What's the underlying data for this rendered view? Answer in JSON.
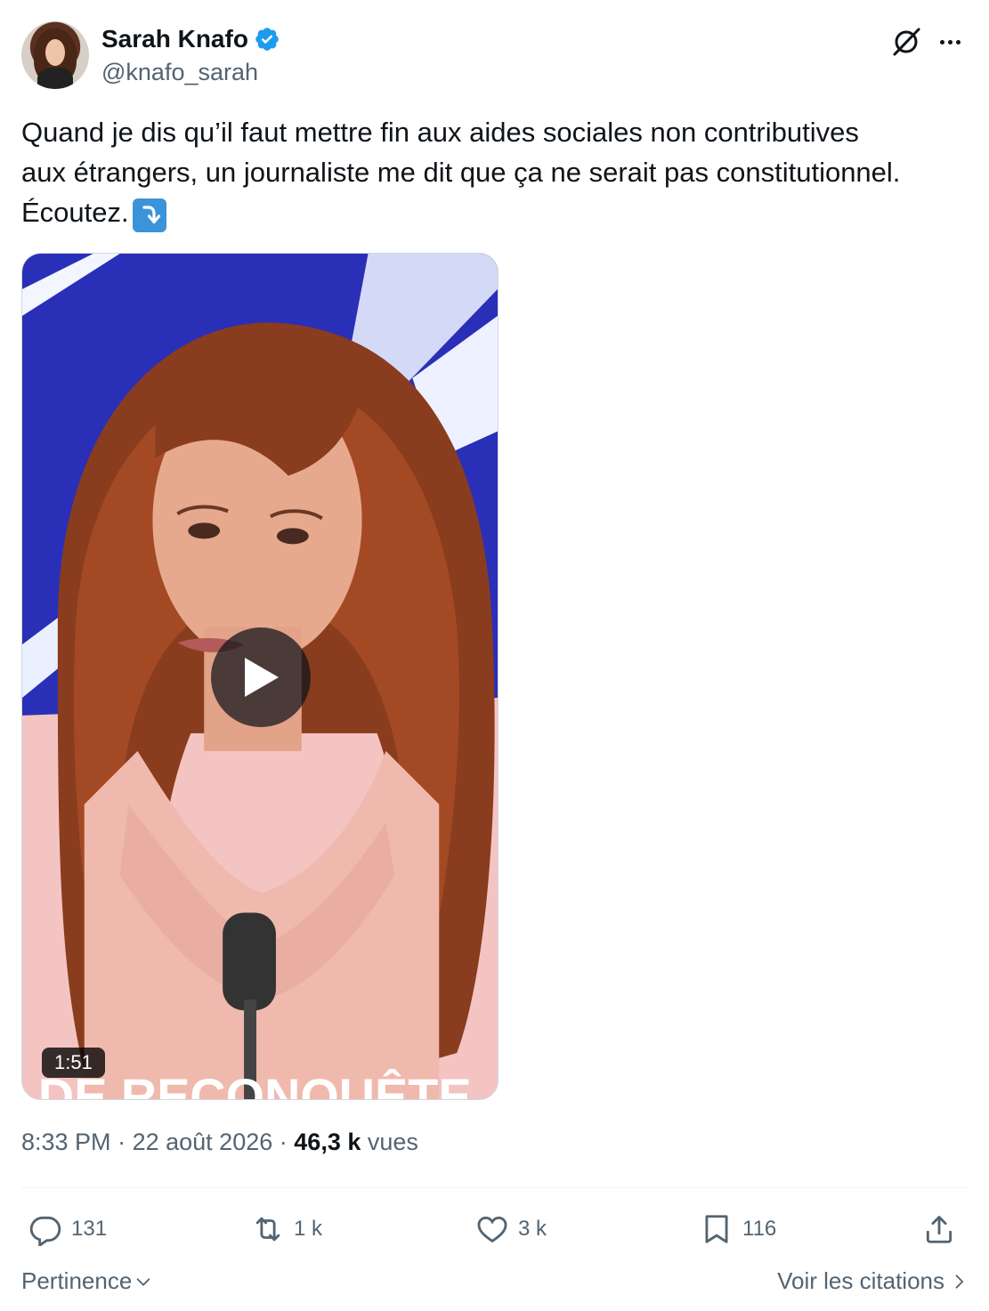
{
  "author": {
    "name": "Sarah Knafo",
    "handle": "@knafo_sarah",
    "verified": true
  },
  "tweet": {
    "text_line1": "Quand je dis qu’il faut mettre fin aux aides sociales non contributives",
    "text_line2": "aux étrangers, un journaliste me dit que ça ne serait pas constitutionnel.",
    "text_line3": "Écoutez.",
    "emoji": "arrow-curving-down-icon"
  },
  "media": {
    "type": "video",
    "duration": "1:51",
    "caption_text": "DE RECONQUÊTE"
  },
  "meta": {
    "time": "8:33 PM",
    "date": "22 août 2026",
    "separator": "·",
    "views_count": "46,3 k",
    "views_label": "vues"
  },
  "actions": {
    "replies": "131",
    "reposts": "1 k",
    "likes": "3 k",
    "bookmarks": "116"
  },
  "footer": {
    "sort_label": "Pertinence",
    "quotes_label": "Voir les citations"
  },
  "colors": {
    "text_primary": "#0f1419",
    "text_secondary": "#536471",
    "verified_blue": "#1d9bf0",
    "divider": "#eff3f4"
  }
}
